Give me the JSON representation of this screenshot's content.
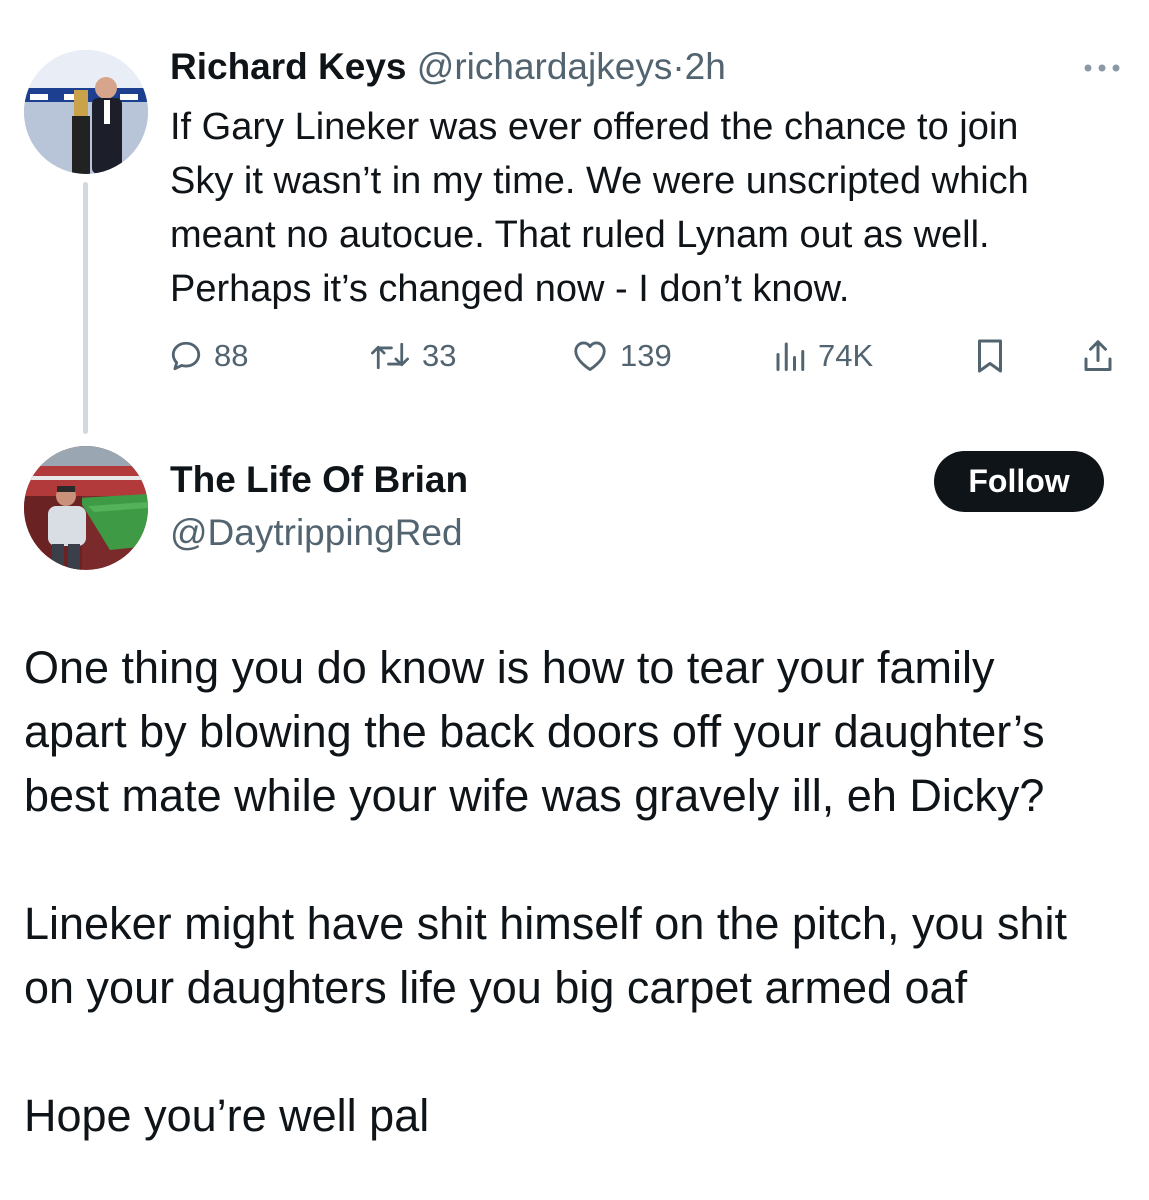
{
  "tweet1": {
    "name": "Richard Keys",
    "handle": "@richardajkeys",
    "separator": "·",
    "time": "2h",
    "more_icon": "ellipsis-icon",
    "lines": [
      "If Gary Lineker was ever offered the chance to join",
      "Sky it wasn’t in my time. We were unscripted which",
      "meant no autocue. That ruled Lynam out as well.",
      "Perhaps it’s changed now - I don’t know."
    ],
    "actions": {
      "replies": {
        "icon": "reply-icon",
        "count": "88"
      },
      "retweets": {
        "icon": "retweet-icon",
        "count": "33"
      },
      "likes": {
        "icon": "heart-icon",
        "count": "139"
      },
      "views": {
        "icon": "analytics-icon",
        "count": "74K"
      },
      "bookmark": {
        "icon": "bookmark-icon"
      },
      "share": {
        "icon": "share-icon"
      }
    }
  },
  "tweet2": {
    "name": "The Life Of Brian",
    "handle": "@DaytrippingRed",
    "follow_label": "Follow",
    "paragraph1": [
      "One thing you do know is how to tear your family",
      "apart by blowing the back doors off your daughter’s",
      "best mate while your wife was gravely ill, eh Dicky?"
    ],
    "paragraph2": [
      "Lineker might have shit himself on the pitch, you shit",
      "on your daughters life you big carpet armed oaf"
    ],
    "paragraph3": [
      "Hope you’re well pal"
    ]
  },
  "colors": {
    "text": "#0f1419",
    "secondary": "#536471",
    "thread_line": "#cfd9de",
    "button_bg": "#0f1419",
    "button_text": "#ffffff"
  }
}
